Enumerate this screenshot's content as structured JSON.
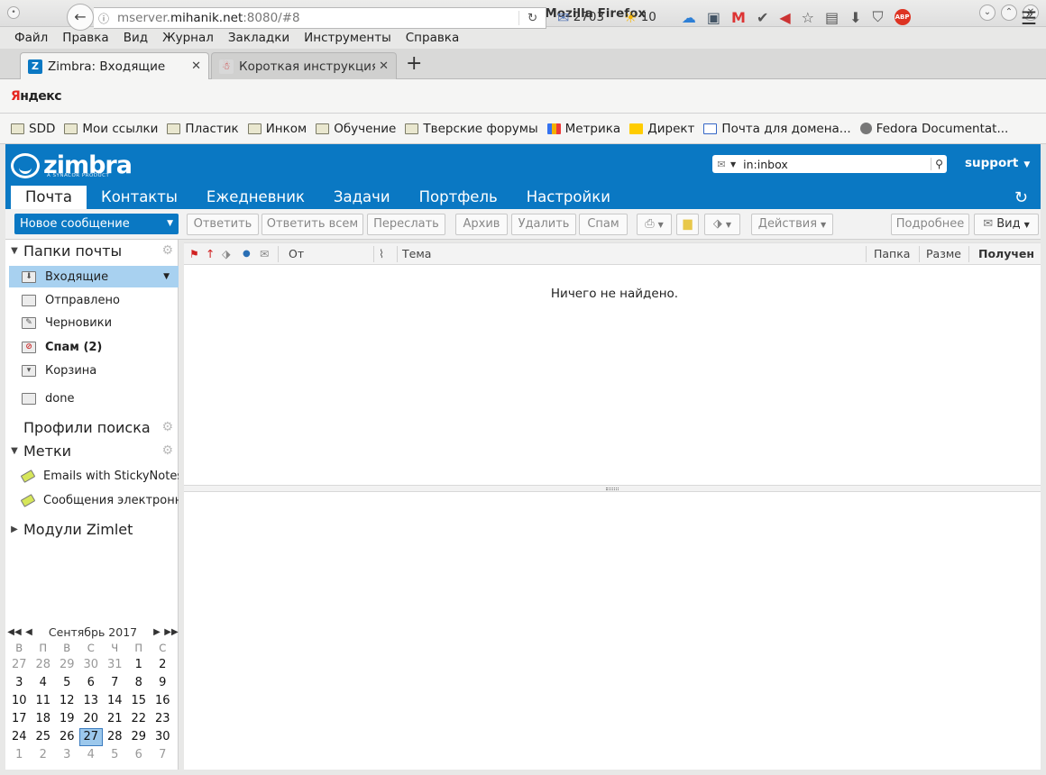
{
  "window": {
    "title": "Zimbra: Входящие - Mozilla Firefox"
  },
  "menu": [
    "Файл",
    "Правка",
    "Вид",
    "Журнал",
    "Закладки",
    "Инструменты",
    "Справка"
  ],
  "tabs": [
    {
      "label": "Zimbra: Входящие"
    },
    {
      "label": "Короткая инструкция"
    }
  ],
  "nav": {
    "yandex_prefix": "Я",
    "yandex_rest": "ндекс",
    "url_host_prefix": "mserver.",
    "url_host_main": "mihanik.net",
    "url_rest": ":8080/#8",
    "mail_count": "2703",
    "weather": "10"
  },
  "bookmarks": [
    {
      "label": "SDD"
    },
    {
      "label": "Мои ссылки"
    },
    {
      "label": "Пластик"
    },
    {
      "label": "Инком"
    },
    {
      "label": "Обучение"
    },
    {
      "label": "Тверские форумы"
    },
    {
      "label": "Метрика"
    },
    {
      "label": "Директ"
    },
    {
      "label": "Почта для домена..."
    },
    {
      "label": "Fedora Documentat..."
    }
  ],
  "zimbra": {
    "logo": "zimbra",
    "logo_sub": "A SYNACOR PRODUCT",
    "search_value": "in:inbox",
    "user": "support",
    "app_tabs": [
      "Почта",
      "Контакты",
      "Ежедневник",
      "Задачи",
      "Портфель",
      "Настройки"
    ]
  },
  "toolbar": {
    "new_message": "Новое сообщение",
    "reply": "Ответить",
    "reply_all": "Ответить всем",
    "forward": "Переслать",
    "archive": "Архив",
    "delete": "Удалить",
    "spam": "Спам",
    "actions": "Действия",
    "more": "Подробнее",
    "view": "Вид"
  },
  "sidebar": {
    "mail_folders": "Папки почты",
    "folders": [
      {
        "label": "Входящие"
      },
      {
        "label": "Отправлено"
      },
      {
        "label": "Черновики"
      },
      {
        "label": "Спам (2)"
      },
      {
        "label": "Корзина"
      },
      {
        "label": "done"
      }
    ],
    "search_profiles": "Профили поиска",
    "tags_header": "Метки",
    "tags": [
      {
        "label": "Emails with StickyNotes"
      },
      {
        "label": "Сообщения электронно"
      }
    ],
    "zimlets": "Модули Zimlet"
  },
  "calendar": {
    "month": "Сентябрь 2017",
    "dow": [
      "В",
      "П",
      "В",
      "С",
      "Ч",
      "П",
      "С"
    ],
    "weeks": [
      [
        "27",
        "28",
        "29",
        "30",
        "31",
        "1",
        "2"
      ],
      [
        "3",
        "4",
        "5",
        "6",
        "7",
        "8",
        "9"
      ],
      [
        "10",
        "11",
        "12",
        "13",
        "14",
        "15",
        "16"
      ],
      [
        "17",
        "18",
        "19",
        "20",
        "21",
        "22",
        "23"
      ],
      [
        "24",
        "25",
        "26",
        "27",
        "28",
        "29",
        "30"
      ],
      [
        "1",
        "2",
        "3",
        "4",
        "5",
        "6",
        "7"
      ]
    ],
    "today": "27"
  },
  "list": {
    "col_from": "От",
    "col_subject": "Тема",
    "col_folder": "Папка",
    "col_size": "Разме",
    "col_received": "Получен",
    "empty": "Ничего не найдено."
  }
}
